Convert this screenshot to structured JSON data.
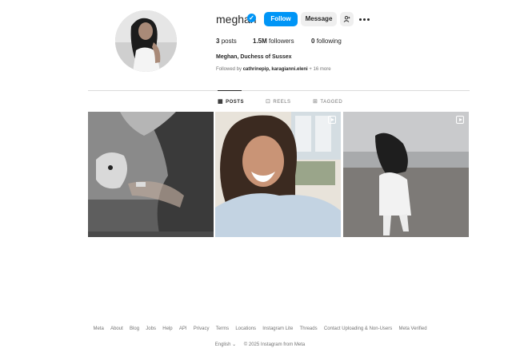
{
  "profile": {
    "username": "meghan",
    "full_name": "Meghan, Duchess of Sussex",
    "followed_by_prefix": "Followed by ",
    "followed_by_users": "cathrinepip, karagianni.eleni",
    "followed_by_more": " + 16 more",
    "posts_count": "3",
    "posts_label": "posts",
    "followers_count": "1.5M",
    "followers_label": "followers",
    "following_count": "0",
    "following_label": "following"
  },
  "actions": {
    "follow_label": "Follow",
    "message_label": "Message"
  },
  "tabs": [
    {
      "label": "POSTS",
      "icon": "grid-icon",
      "active": true
    },
    {
      "label": "REELS",
      "icon": "reels-icon",
      "active": false
    },
    {
      "label": "TAGGED",
      "icon": "tagged-icon",
      "active": false
    }
  ],
  "posts": [
    {
      "kind": "photo",
      "reel": false
    },
    {
      "kind": "video",
      "reel": true
    },
    {
      "kind": "video",
      "reel": true
    }
  ],
  "footer": {
    "links": [
      "Meta",
      "About",
      "Blog",
      "Jobs",
      "Help",
      "API",
      "Privacy",
      "Terms",
      "Locations",
      "Instagram Lite",
      "Threads",
      "Contact Uploading & Non-Users",
      "Meta Verified"
    ],
    "language": "English",
    "copyright": "© 2025 Instagram from Meta"
  },
  "colors": {
    "accent": "#0095f6",
    "text": "#262626",
    "muted": "#737373",
    "button_bg": "#efefef"
  }
}
